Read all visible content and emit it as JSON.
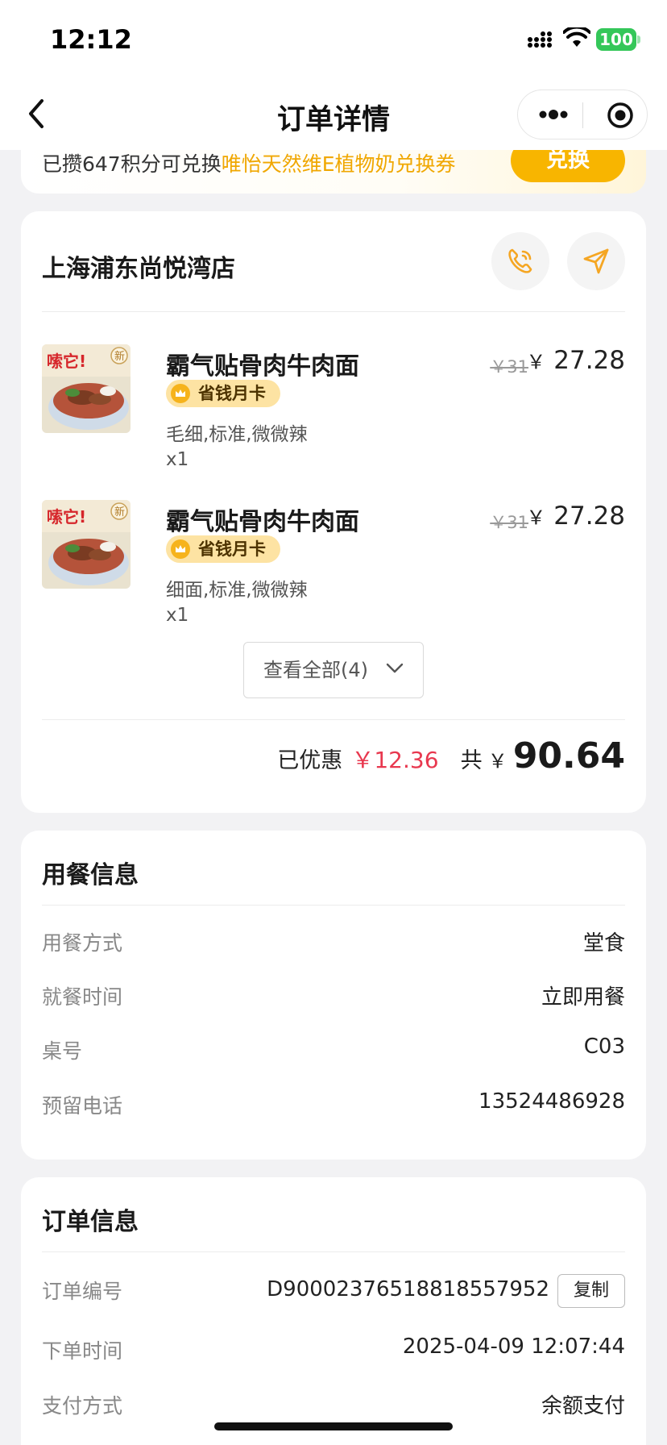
{
  "status_bar": {
    "time": "12:12",
    "battery": "100"
  },
  "nav": {
    "title": "订单详情"
  },
  "points_banner": {
    "text": "已攒647积分可兑换",
    "link": "唯怡天然维E植物奶兑换券",
    "button": "兑换"
  },
  "store": {
    "name": "上海浦东尚悦湾店",
    "items": [
      {
        "name": "霸气贴骨肉牛肉面",
        "badge": "省钱月卡",
        "spec": "毛细,标准,微微辣",
        "qty": "x1",
        "orig_price": "￥31",
        "price_symbol": "￥",
        "price": "27.28"
      },
      {
        "name": "霸气贴骨肉牛肉面",
        "badge": "省钱月卡",
        "spec": "细面,标准,微微辣",
        "qty": "x1",
        "orig_price": "￥31",
        "price_symbol": "￥",
        "price": "27.28"
      }
    ],
    "view_all": "查看全部(4)",
    "discount_label": "已优惠",
    "discount_value": "￥12.36",
    "total_label": "共",
    "total_symbol": "￥",
    "total_value": "90.64"
  },
  "dine_info": {
    "title": "用餐信息",
    "rows": [
      {
        "label": "用餐方式",
        "value": "堂食"
      },
      {
        "label": "就餐时间",
        "value": "立即用餐"
      },
      {
        "label": "桌号",
        "value": "C03"
      },
      {
        "label": "预留电话",
        "value": "13524486928"
      }
    ]
  },
  "order_info": {
    "title": "订单信息",
    "rows": [
      {
        "label": "订单编号",
        "value": "D90002376518818557952"
      },
      {
        "label": "下单时间",
        "value": "2025-04-09 12:07:44"
      },
      {
        "label": "支付方式",
        "value": "余额支付"
      }
    ],
    "copy_button": "复制"
  },
  "food_image": {
    "banner": "嗦它!",
    "tag": "新"
  },
  "colors": {
    "accent": "#f8b500",
    "discount": "#e8384f",
    "battery": "#34c759"
  }
}
